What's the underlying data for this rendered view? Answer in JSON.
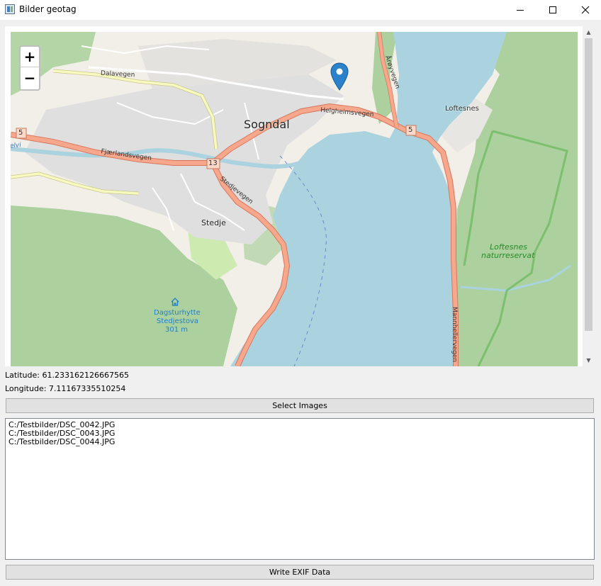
{
  "window": {
    "title": "Bilder geotag",
    "controls": [
      "minimize",
      "maximize",
      "close"
    ]
  },
  "map": {
    "zoom_in_label": "+",
    "zoom_out_label": "−",
    "marker_icon": "map-pin-icon",
    "colors": {
      "water": "#aad3df",
      "forest": "#add19e",
      "urban": "#e0dfdf",
      "primary_road": "#f6a78c",
      "secondary_road": "#f7fabf",
      "land": "#f2efe9",
      "nature_reserve_border": "#6fba63",
      "marker": "#2b82cb"
    },
    "labels": {
      "town": "Sogndal",
      "stedje": "Stedje",
      "loftesnes": "Loftesnes",
      "reserve_line1": "Loftesnes",
      "reserve_line2": "naturreservat",
      "hut_line1": "Dagsturhytte",
      "hut_line2": "Stedjestova",
      "hut_line3": "301 m",
      "dalavegen": "Dalavegen",
      "fjaerlandsvegen": "Fjærlandsvegen",
      "helgheimsvegen": "Helgheimsvegen",
      "stedjevegen": "Stedjevegen",
      "aroyvegen": "Årøyvegen",
      "manhellervegen": "Mannhellervegen",
      "river": "Sogndalselvi",
      "shield_5a": "5",
      "shield_5b": "5",
      "shield_13": "13"
    }
  },
  "coordinates": {
    "latitude": "Latitude: 61.233162126667565",
    "longitude": "Longitude: 7.11167335510254"
  },
  "buttons": {
    "select_images": "Select Images",
    "write_exif": "Write EXIF Data"
  },
  "files": [
    "C:/Testbilder/DSC_0042.JPG",
    "C:/Testbilder/DSC_0043.JPG",
    "C:/Testbilder/DSC_0044.JPG"
  ]
}
